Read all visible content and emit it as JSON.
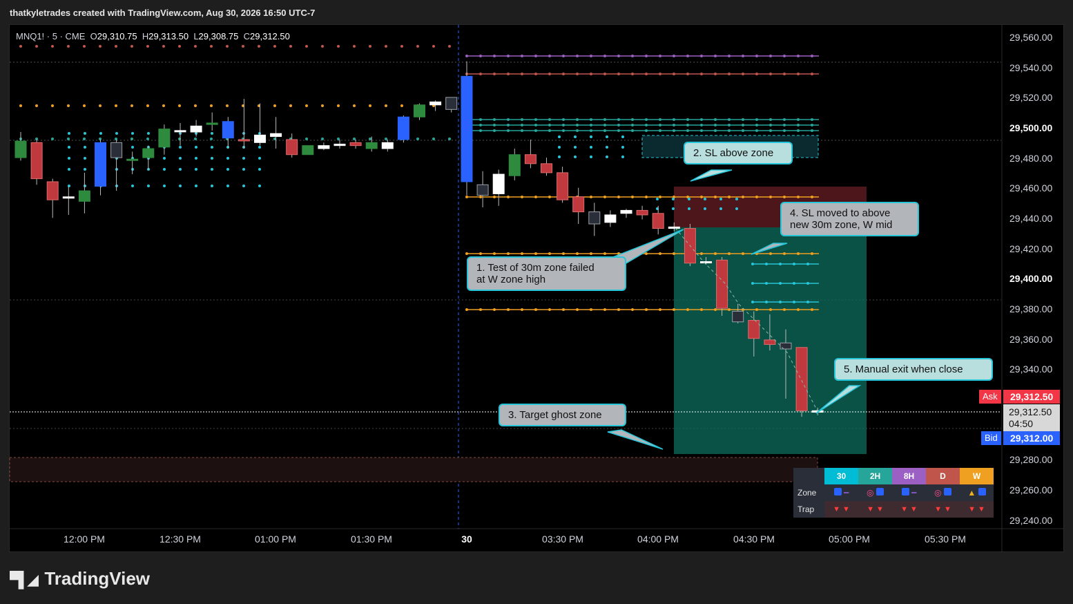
{
  "header": {
    "attribution": "thatkyletrades created with TradingView.com, Aug 30, 2026 16:50 UTC-7"
  },
  "symbol": {
    "name": "MNQ1! · 5 · CME",
    "o_label": "O",
    "o": "29,310.75",
    "h_label": "H",
    "h": "29,313.50",
    "l_label": "L",
    "l": "29,308.75",
    "c_label": "C",
    "c": "29,312.50"
  },
  "price_axis": {
    "ticks": [
      "29,560.00",
      "29,540.00",
      "29,520.00",
      "29,500.00",
      "29,480.00",
      "29,460.00",
      "29,440.00",
      "29,420.00",
      "29,400.00",
      "29,380.00",
      "29,360.00",
      "29,340.00",
      "29,280.00",
      "29,260.00",
      "29,240.00"
    ],
    "ask_label": "Ask",
    "ask_price": "29,312.50",
    "bid_label": "Bid",
    "bid_price": "29,312.00",
    "last_price": "29,312.50",
    "countdown": "04:50"
  },
  "time_axis": {
    "ticks": [
      "12:00 PM",
      "12:30 PM",
      "01:00 PM",
      "01:30 PM",
      "30",
      "03:30 PM",
      "04:00 PM",
      "04:30 PM",
      "05:00 PM",
      "05:30 PM"
    ]
  },
  "callouts": {
    "c1": "1. Test of 30m zone failed\nat W zone high",
    "c2": "2. SL above zone",
    "c3": "3. Target ghost zone",
    "c4": "4. SL moved to above\nnew 30m zone, W mid",
    "c5": "5. Manual exit when close"
  },
  "zone_table": {
    "headers": [
      "30",
      "2H",
      "8H",
      "D",
      "W"
    ],
    "header_colors": [
      "#00bcd4",
      "#26a69a",
      "#9c5fc4",
      "#c0564b",
      "#f0a020"
    ],
    "row_labels": [
      "Zone",
      "Trap"
    ],
    "trap_values": [
      "▼ ▼",
      "▼ ▼",
      "▼ ▼",
      "▼ ▼",
      "▼ ▼"
    ]
  },
  "colors": {
    "up": "#2e8b3e",
    "down": "#c0393e",
    "accent_blue": "#2962ff",
    "ask": "#f23645"
  },
  "brand": {
    "name": "TradingView"
  },
  "chart_data": {
    "type": "candlestick",
    "symbol": "MNQ1!",
    "interval": "5",
    "y_range": [
      29235,
      29568
    ],
    "x_ticks": [
      "12:00 PM",
      "12:30 PM",
      "01:00 PM",
      "01:30 PM",
      "30",
      "03:30 PM",
      "04:00 PM",
      "04:30 PM",
      "05:00 PM",
      "05:30 PM"
    ],
    "candles": [
      {
        "o": 29480,
        "h": 29497,
        "l": 29478,
        "c": 29491,
        "col": "g"
      },
      {
        "o": 29490,
        "h": 29492,
        "l": 29462,
        "c": 29466,
        "col": "r"
      },
      {
        "o": 29464,
        "h": 29466,
        "l": 29440,
        "c": 29452,
        "col": "r"
      },
      {
        "o": 29454,
        "h": 29461,
        "l": 29442,
        "c": 29454,
        "col": "w"
      },
      {
        "o": 29451,
        "h": 29470,
        "l": 29443,
        "c": 29458,
        "col": "g"
      },
      {
        "o": 29461,
        "h": 29492,
        "l": 29455,
        "c": 29490,
        "col": "b"
      },
      {
        "o": 29490,
        "h": 29492,
        "l": 29458,
        "c": 29480,
        "col": "k"
      },
      {
        "o": 29479,
        "h": 29484,
        "l": 29469,
        "c": 29479,
        "col": "g"
      },
      {
        "o": 29480,
        "h": 29488,
        "l": 29472,
        "c": 29486,
        "col": "g"
      },
      {
        "o": 29487,
        "h": 29502,
        "l": 29482,
        "c": 29499,
        "col": "g"
      },
      {
        "o": 29498,
        "h": 29503,
        "l": 29488,
        "c": 29498,
        "col": "w"
      },
      {
        "o": 29497,
        "h": 29505,
        "l": 29494,
        "c": 29501,
        "col": "w"
      },
      {
        "o": 29502,
        "h": 29510,
        "l": 29498,
        "c": 29503,
        "col": "g"
      },
      {
        "o": 29504,
        "h": 29507,
        "l": 29486,
        "c": 29493,
        "col": "b"
      },
      {
        "o": 29492,
        "h": 29519,
        "l": 29486,
        "c": 29492,
        "col": "r"
      },
      {
        "o": 29490,
        "h": 29516,
        "l": 29488,
        "c": 29495,
        "col": "w"
      },
      {
        "o": 29494,
        "h": 29507,
        "l": 29486,
        "c": 29496,
        "col": "w"
      },
      {
        "o": 29492,
        "h": 29496,
        "l": 29480,
        "c": 29482,
        "col": "r"
      },
      {
        "o": 29482,
        "h": 29488,
        "l": 29484,
        "c": 29488,
        "col": "g"
      },
      {
        "o": 29486,
        "h": 29490,
        "l": 29485,
        "c": 29488,
        "col": "w"
      },
      {
        "o": 29488,
        "h": 29492,
        "l": 29486,
        "c": 29489,
        "col": "w"
      },
      {
        "o": 29490,
        "h": 29492,
        "l": 29486,
        "c": 29488,
        "col": "r"
      },
      {
        "o": 29486,
        "h": 29494,
        "l": 29484,
        "c": 29490,
        "col": "g"
      },
      {
        "o": 29486,
        "h": 29492,
        "l": 29484,
        "c": 29490,
        "col": "w"
      },
      {
        "o": 29492,
        "h": 29508,
        "l": 29490,
        "c": 29507,
        "col": "b"
      },
      {
        "o": 29507,
        "h": 29516,
        "l": 29505,
        "c": 29515,
        "col": "g"
      },
      {
        "o": 29515,
        "h": 29518,
        "l": 29511,
        "c": 29517,
        "col": "w"
      },
      {
        "o": 29512,
        "h": 29520,
        "l": 29510,
        "c": 29520,
        "col": "k"
      },
      {
        "o": 29534,
        "h": 29544,
        "l": 29455,
        "c": 29464,
        "col": "b"
      },
      {
        "o": 29462,
        "h": 29471,
        "l": 29447,
        "c": 29455,
        "col": "k"
      },
      {
        "o": 29456,
        "h": 29472,
        "l": 29448,
        "c": 29469,
        "col": "w"
      },
      {
        "o": 29468,
        "h": 29486,
        "l": 29465,
        "c": 29482,
        "col": "g"
      },
      {
        "o": 29482,
        "h": 29492,
        "l": 29473,
        "c": 29476,
        "col": "r"
      },
      {
        "o": 29476,
        "h": 29480,
        "l": 29468,
        "c": 29470,
        "col": "r"
      },
      {
        "o": 29470,
        "h": 29474,
        "l": 29450,
        "c": 29452,
        "col": "r"
      },
      {
        "o": 29454,
        "h": 29460,
        "l": 29436,
        "c": 29444,
        "col": "r"
      },
      {
        "o": 29444,
        "h": 29450,
        "l": 29428,
        "c": 29436,
        "col": "k"
      },
      {
        "o": 29437,
        "h": 29445,
        "l": 29434,
        "c": 29442,
        "col": "w"
      },
      {
        "o": 29443,
        "h": 29446,
        "l": 29440,
        "c": 29445,
        "col": "w"
      },
      {
        "o": 29445,
        "h": 29448,
        "l": 29439,
        "c": 29442,
        "col": "r"
      },
      {
        "o": 29443,
        "h": 29448,
        "l": 29429,
        "c": 29433,
        "col": "r"
      },
      {
        "o": 29434,
        "h": 29437,
        "l": 29431,
        "c": 29433,
        "col": "w"
      },
      {
        "o": 29433,
        "h": 29436,
        "l": 29408,
        "c": 29410,
        "col": "r"
      },
      {
        "o": 29411,
        "h": 29414,
        "l": 29409,
        "c": 29411,
        "col": "w"
      },
      {
        "o": 29412,
        "h": 29414,
        "l": 29375,
        "c": 29380,
        "col": "r"
      },
      {
        "o": 29378,
        "h": 29383,
        "l": 29370,
        "c": 29371,
        "col": "k"
      },
      {
        "o": 29372,
        "h": 29378,
        "l": 29348,
        "c": 29360,
        "col": "r"
      },
      {
        "o": 29359,
        "h": 29376,
        "l": 29352,
        "c": 29356,
        "col": "r"
      },
      {
        "o": 29357,
        "h": 29366,
        "l": 29320,
        "c": 29353,
        "col": "k"
      },
      {
        "o": 29354,
        "h": 29354,
        "l": 29308,
        "c": 29312,
        "col": "r"
      },
      {
        "o": 29311,
        "h": 29314,
        "l": 29309,
        "c": 29312,
        "col": "w"
      }
    ]
  }
}
